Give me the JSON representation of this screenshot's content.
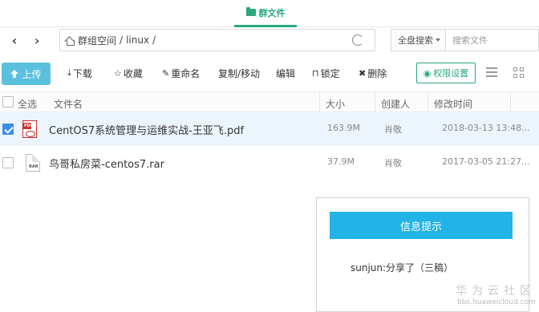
{
  "tabs": {
    "active_label": "群文件"
  },
  "nav": {
    "back_glyph": "‹",
    "forward_glyph": "›"
  },
  "path": {
    "root": "群组空间",
    "sep1": "/",
    "folder": "linux",
    "sep2": "/"
  },
  "search": {
    "scope": "全盘搜索",
    "placeholder": "搜索文件"
  },
  "toolbar": {
    "upload": "上传",
    "download": "下载",
    "favorite": "收藏",
    "rename": "重命名",
    "copy_move": "复制/移动",
    "edit": "编辑",
    "lock": "锁定",
    "delete": "删除",
    "permissions": "权限设置"
  },
  "table": {
    "headers": {
      "select_all": "全选",
      "name": "文件名",
      "size": "大小",
      "creator": "创建人",
      "modified": "修改时间"
    },
    "rows": [
      {
        "name": "CentOS7系统管理与运维实战-王亚飞.pdf",
        "size": "163.9M",
        "creator": "肖敬",
        "modified": "2018-03-13 13:48...",
        "type": "pdf",
        "selected": true
      },
      {
        "name": "鸟哥私房菜-centos7.rar",
        "size": "37.9M",
        "creator": "肖敬",
        "modified": "2017-03-05 21:27...",
        "type": "rar",
        "selected": false
      }
    ]
  },
  "popup": {
    "title": "信息提示",
    "message": "sunjun:分享了（三稿）"
  },
  "watermark": {
    "text": "华为云社区",
    "url": "bbs.huaweicloud.com"
  },
  "colors": {
    "accent_green": "#2aa77b",
    "upload_blue": "#5bc0de",
    "popup_blue": "#22b4e6",
    "check_blue": "#3a8ee6"
  },
  "icons": {
    "tab": "folder-icon",
    "home": "home-icon",
    "refresh": "refresh-icon",
    "upload": "upload-icon",
    "download": "download-icon",
    "favorite": "star-icon",
    "rename": "edit-icon",
    "lock": "lock-icon",
    "delete": "close-icon",
    "permissions": "eye-icon",
    "list_view": "list-view-icon",
    "grid_view": "grid-view-icon",
    "pdf": "pdf-file-icon",
    "rar": "rar-file-icon"
  }
}
